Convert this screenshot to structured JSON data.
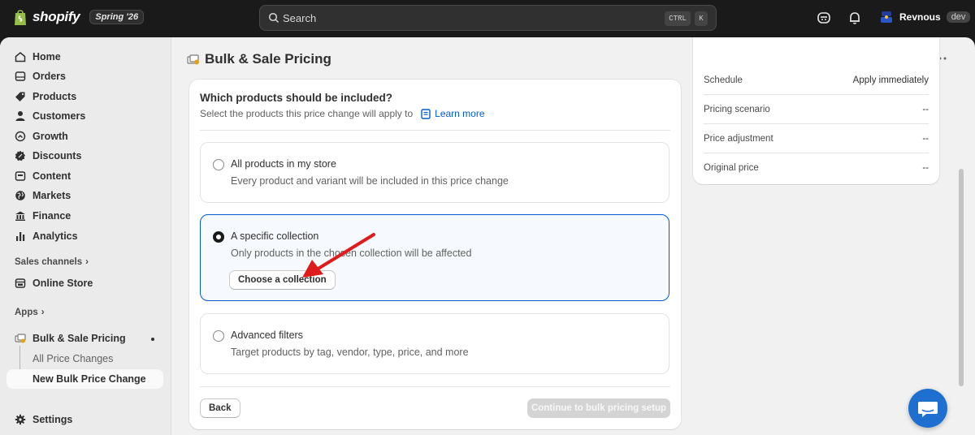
{
  "topbar": {
    "brand": "shopify",
    "edition": "Spring '26",
    "search_placeholder": "Search",
    "shortcut_ctrl": "CTRL",
    "shortcut_key": "K",
    "user_name": "Revnous",
    "user_badge": "dev"
  },
  "sidebar": {
    "items": [
      {
        "label": "Home",
        "icon": "home-icon"
      },
      {
        "label": "Orders",
        "icon": "orders-icon"
      },
      {
        "label": "Products",
        "icon": "tag-icon"
      },
      {
        "label": "Customers",
        "icon": "person-icon"
      },
      {
        "label": "Growth",
        "icon": "growth-icon"
      },
      {
        "label": "Discounts",
        "icon": "discount-icon"
      },
      {
        "label": "Content",
        "icon": "content-icon"
      },
      {
        "label": "Markets",
        "icon": "globe-icon"
      },
      {
        "label": "Finance",
        "icon": "bank-icon"
      },
      {
        "label": "Analytics",
        "icon": "chart-icon"
      }
    ],
    "sales_channels_label": "Sales channels",
    "online_store_label": "Online Store",
    "apps_label": "Apps",
    "app_name": "Bulk & Sale Pricing",
    "app_sub_items": [
      "All Price Changes",
      "New Bulk Price Change"
    ],
    "settings_label": "Settings"
  },
  "page": {
    "title": "Bulk & Sale Pricing"
  },
  "card": {
    "title": "Which products should be included?",
    "subtitle": "Select the products this price change will apply to",
    "learn_more": "Learn more",
    "options": [
      {
        "title": "All products in my store",
        "desc": "Every product and variant will be included in this price change",
        "selected": false
      },
      {
        "title": "A specific collection",
        "desc": "Only products in the chosen collection will be affected",
        "selected": true
      },
      {
        "title": "Advanced filters",
        "desc": "Target products by tag, vendor, type, price, and more",
        "selected": false
      }
    ],
    "choose_collection": "Choose a collection",
    "back": "Back",
    "continue": "Continue to bulk pricing setup"
  },
  "summary": {
    "rows": [
      {
        "label": "Schedule",
        "value": "Apply immediately"
      },
      {
        "label": "Pricing scenario",
        "value": "--"
      },
      {
        "label": "Price adjustment",
        "value": "--"
      },
      {
        "label": "Original price",
        "value": "--"
      }
    ]
  },
  "colors": {
    "accent": "#005bd3",
    "annotation_arrow": "#e01b1b",
    "chat": "#1f6fd1"
  }
}
